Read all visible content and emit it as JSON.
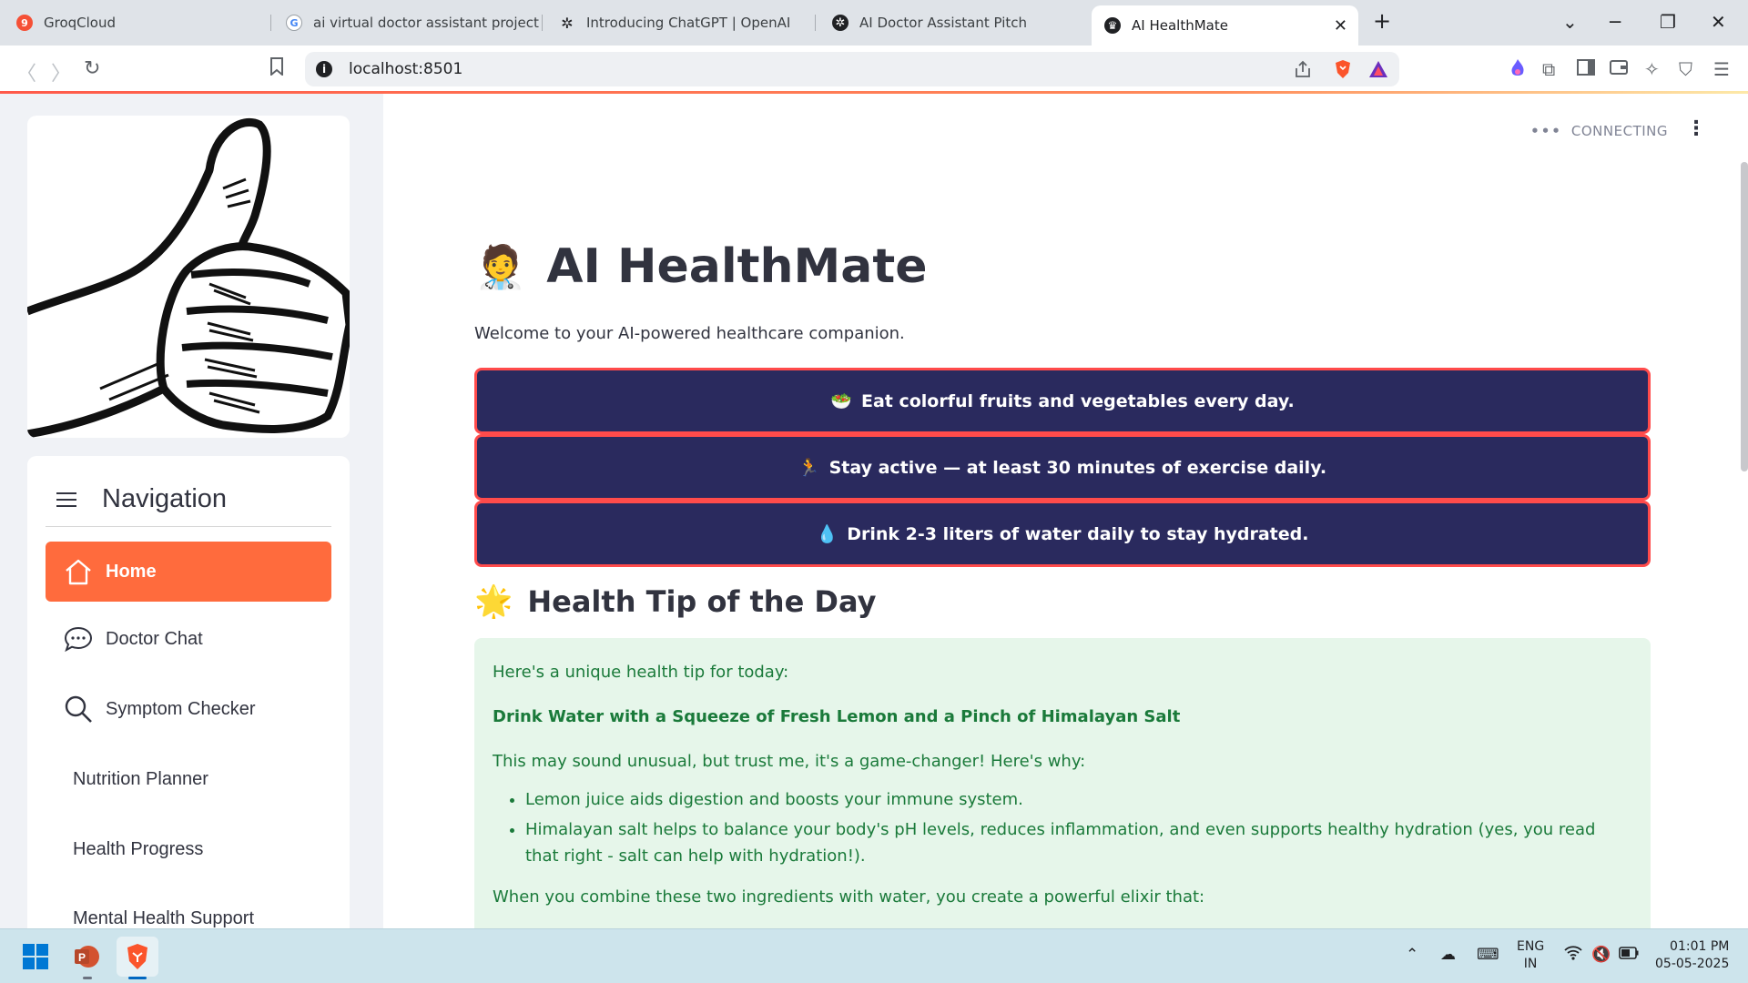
{
  "browser": {
    "tabs": [
      {
        "title": "GroqCloud",
        "favicon": "groq-icon",
        "favicon_text": "9",
        "color": "#f55036"
      },
      {
        "title": "ai virtual doctor assistant project pp",
        "favicon": "google-icon",
        "favicon_text": "G",
        "color": "#4285f4"
      },
      {
        "title": "Introducing ChatGPT | OpenAI",
        "favicon": "openai-icon",
        "favicon_text": "✲",
        "color": "#202124"
      },
      {
        "title": "AI Doctor Assistant Pitch",
        "favicon": "openai-icon",
        "favicon_text": "✲",
        "color": "#202124"
      },
      {
        "title": "AI HealthMate",
        "favicon": "streamlit-icon",
        "favicon_text": "♛",
        "color": "#202124",
        "active": true
      }
    ],
    "url": "localhost:8501",
    "new_tab": "+",
    "close_tab": "✕"
  },
  "status": {
    "dots": "•••",
    "text": "CONNECTING"
  },
  "sidebar": {
    "nav_title": "Navigation",
    "items": [
      {
        "label": "Home",
        "icon": "home-icon",
        "active": true
      },
      {
        "label": "Doctor Chat",
        "icon": "chat-bubble-icon"
      },
      {
        "label": "Symptom Checker",
        "icon": "search-icon"
      },
      {
        "label": "Nutrition Planner"
      },
      {
        "label": "Health Progress"
      },
      {
        "label": "Mental Health Support"
      }
    ]
  },
  "main": {
    "title_emoji": "🧑‍⚕️",
    "title": "AI HealthMate",
    "welcome": "Welcome to your AI-powered healthcare companion.",
    "tips": [
      {
        "emoji": "🥗",
        "text": "Eat colorful fruits and vegetables every day."
      },
      {
        "emoji": "🏃",
        "text": "Stay active — at least 30 minutes of exercise daily."
      },
      {
        "emoji": "💧",
        "text": "Drink 2-3 liters of water daily to stay hydrated."
      }
    ],
    "tip_heading_emoji": "🌟",
    "tip_heading": "Health Tip of the Day",
    "tip_box": {
      "intro": "Here's a unique health tip for today:",
      "headline": "Drink Water with a Squeeze of Fresh Lemon and a Pinch of Himalayan Salt",
      "lead": "This may sound unusual, but trust me, it's a game-changer! Here's why:",
      "bullets": [
        "Lemon juice aids digestion and boosts your immune system.",
        "Himalayan salt helps to balance your body's pH levels, reduces inflammation, and even supports healthy hydration (yes, you read that right - salt can help with hydration!)."
      ],
      "closing": "When you combine these two ingredients with water, you create a powerful elixir that:"
    }
  },
  "taskbar": {
    "lang_top": "ENG",
    "lang_bottom": "IN",
    "time": "01:01 PM",
    "date": "05-05-2025"
  },
  "colors": {
    "accent": "#ff6b3d",
    "tip_button_bg": "#2a2a5e",
    "tip_button_border": "#ff4b4b",
    "tip_box_bg": "#e6f6ea",
    "tip_box_text": "#1a7a3a"
  }
}
